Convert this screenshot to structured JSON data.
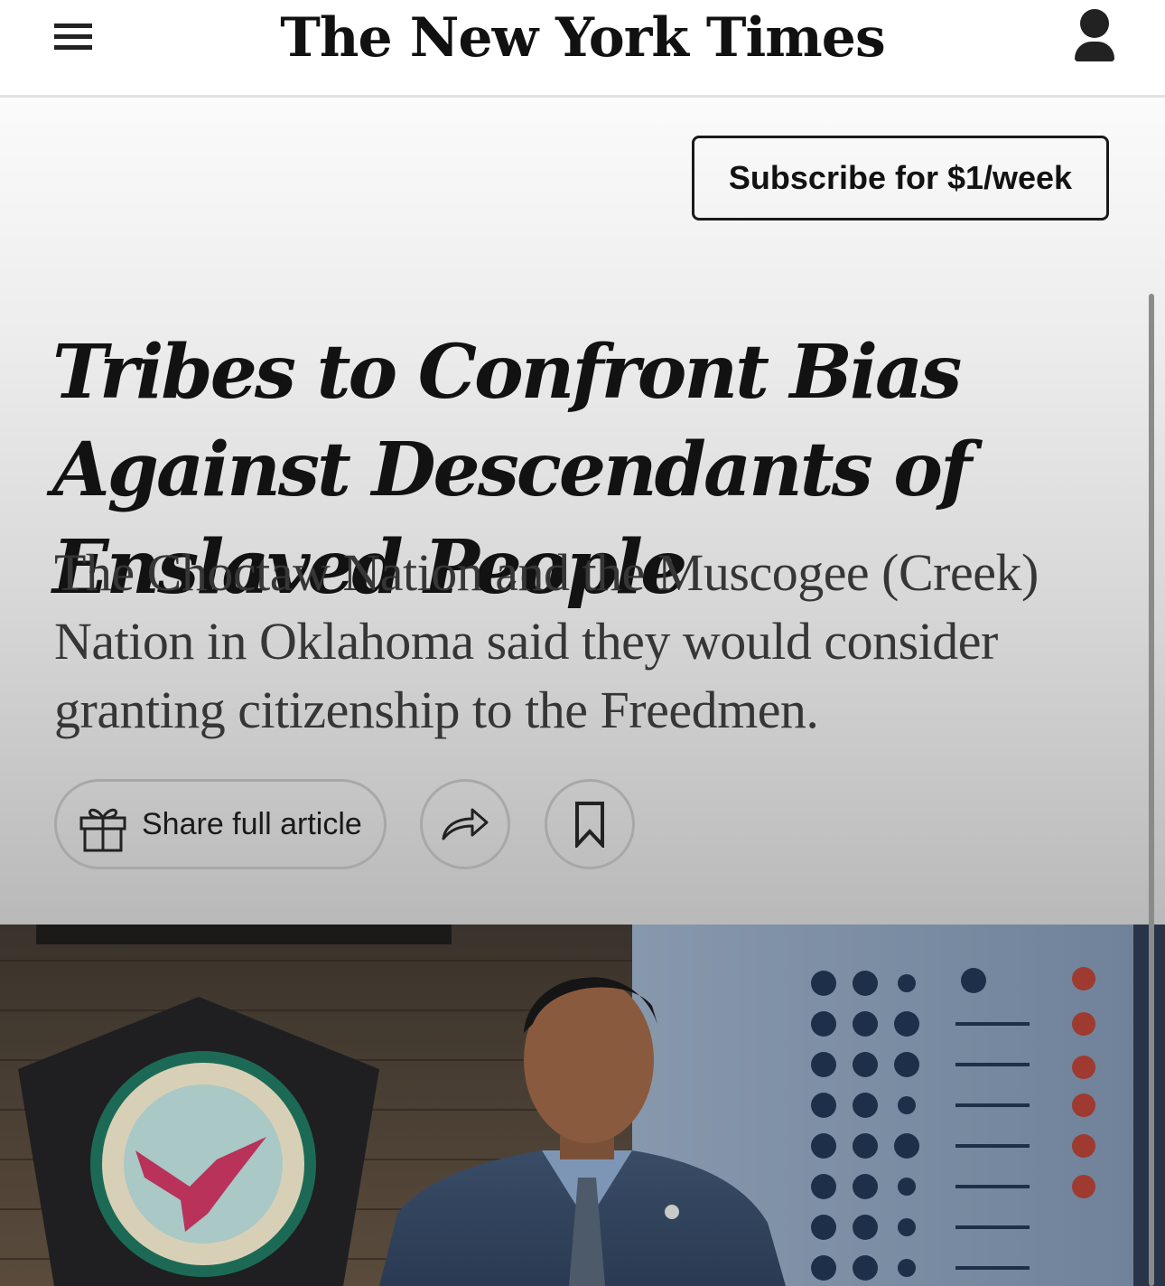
{
  "header": {
    "logo_text": "The New York Times",
    "menu_icon": "hamburger-menu-icon",
    "account_icon": "user-account-icon"
  },
  "hero": {
    "subscribe_label": "Subscribe for $1/week",
    "headline": "Tribes to Confront Bias Against Descendants of Enslaved People",
    "summary": "The Choctaw Nation and the Muscogee (Creek) Nation in Oklahoma said they would consider granting citizenship to the Freedmen.",
    "share_full_label": "Share full article",
    "gift_icon": "gift-icon",
    "share_icon": "share-arrow-icon",
    "bookmark_icon": "bookmark-icon"
  },
  "colors": {
    "text_dark": "#121212",
    "summary_text": "#363636",
    "button_border": "#a8a8a8",
    "eagle_accent": "#b8325a"
  }
}
